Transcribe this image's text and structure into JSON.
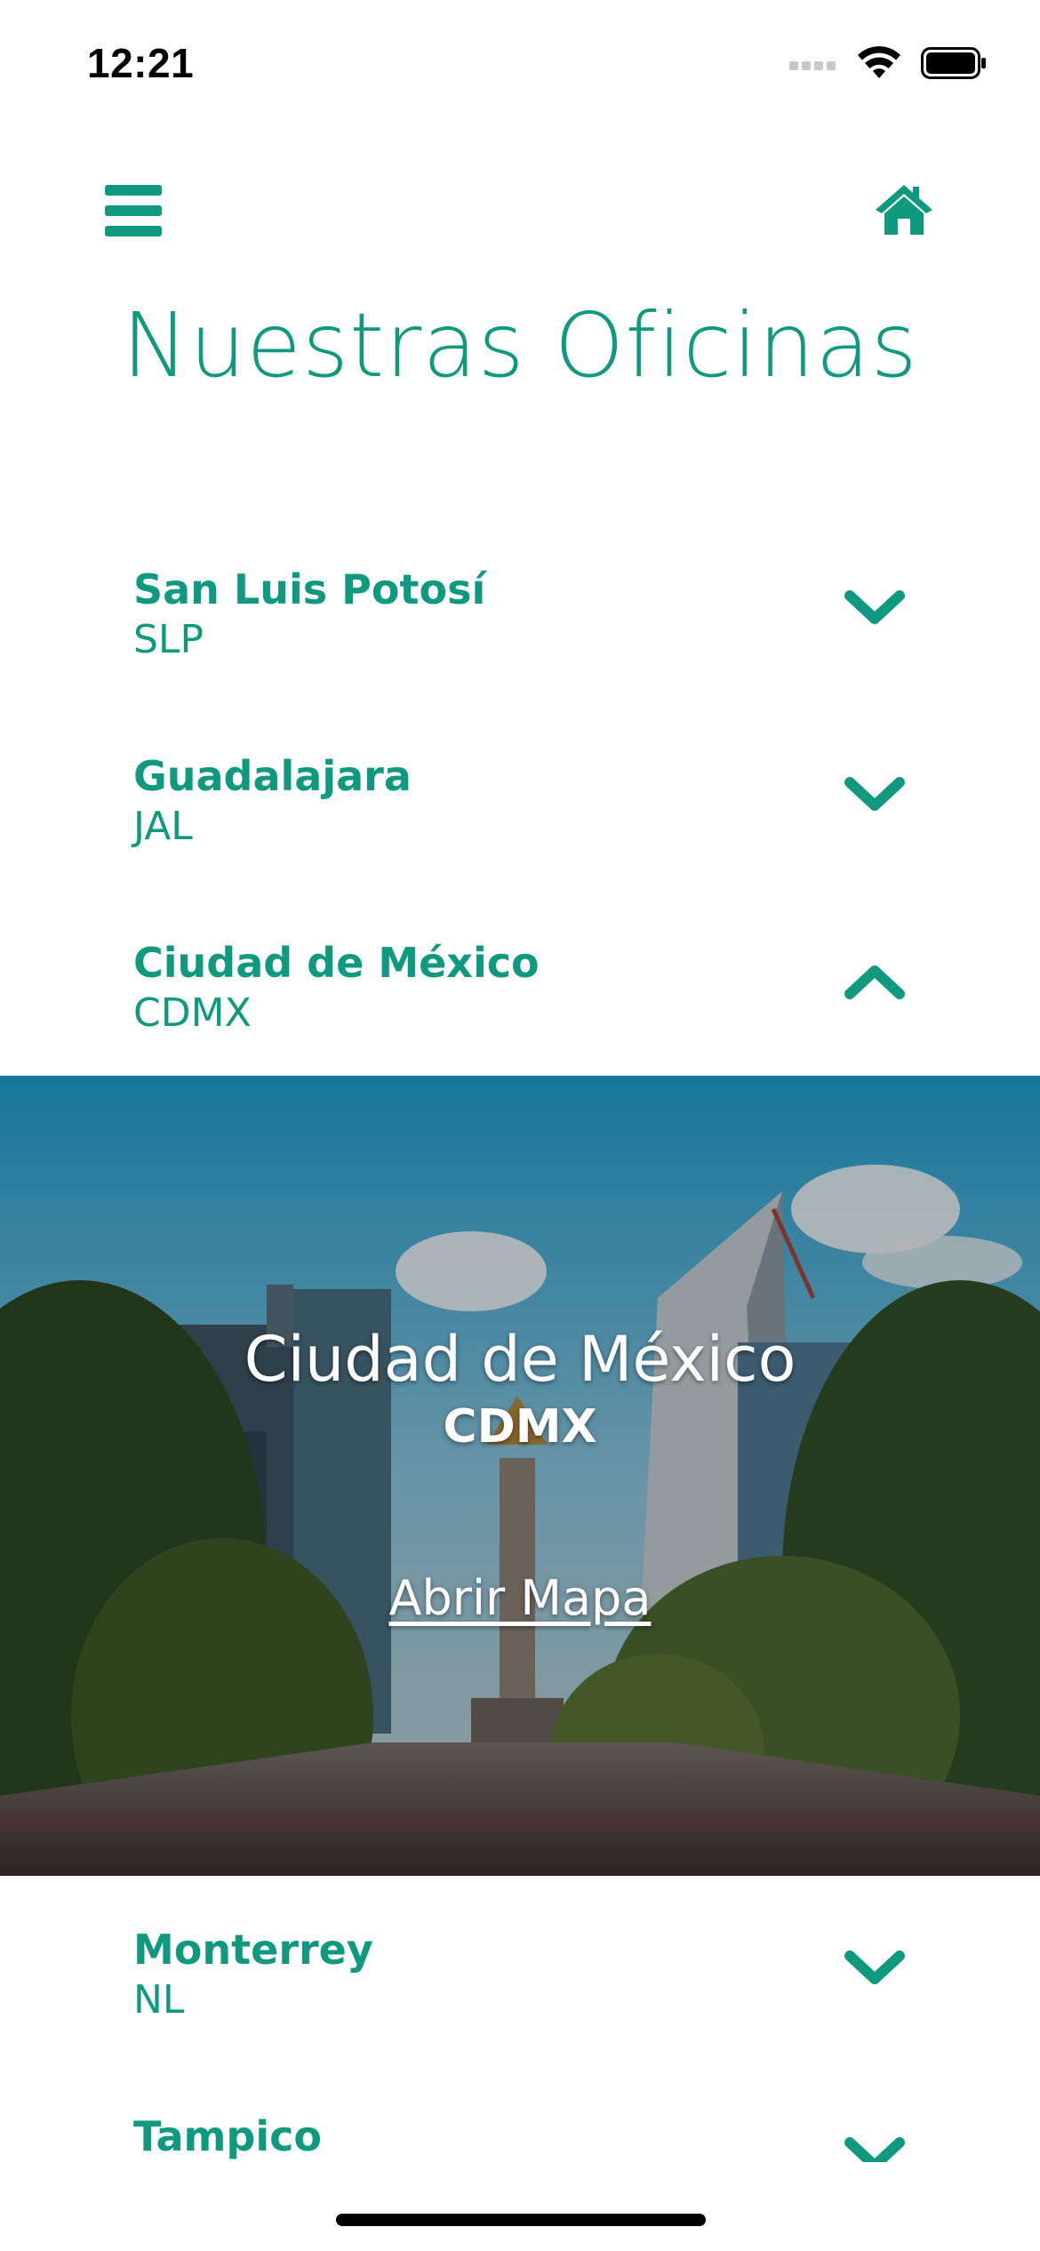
{
  "status_bar": {
    "time": "12:21"
  },
  "header": {
    "title": "Nuestras Oficinas",
    "menu_icon": "hamburger-menu-icon",
    "home_icon": "home-icon"
  },
  "offices": [
    {
      "name": "San Luis Potosí",
      "code": "SLP",
      "expanded": false
    },
    {
      "name": "Guadalajara",
      "code": "JAL",
      "expanded": false
    },
    {
      "name": "Ciudad de México",
      "code": "CDMX",
      "expanded": true
    },
    {
      "name": "Monterrey",
      "code": "NL",
      "expanded": false
    },
    {
      "name": "Tampico",
      "code": "",
      "expanded": false
    }
  ],
  "expanded_panel": {
    "city": "Ciudad de México",
    "code": "CDMX",
    "map_link": "Abrir Mapa"
  },
  "colors": {
    "accent": "#0f9a80",
    "background": "#ffffff"
  }
}
